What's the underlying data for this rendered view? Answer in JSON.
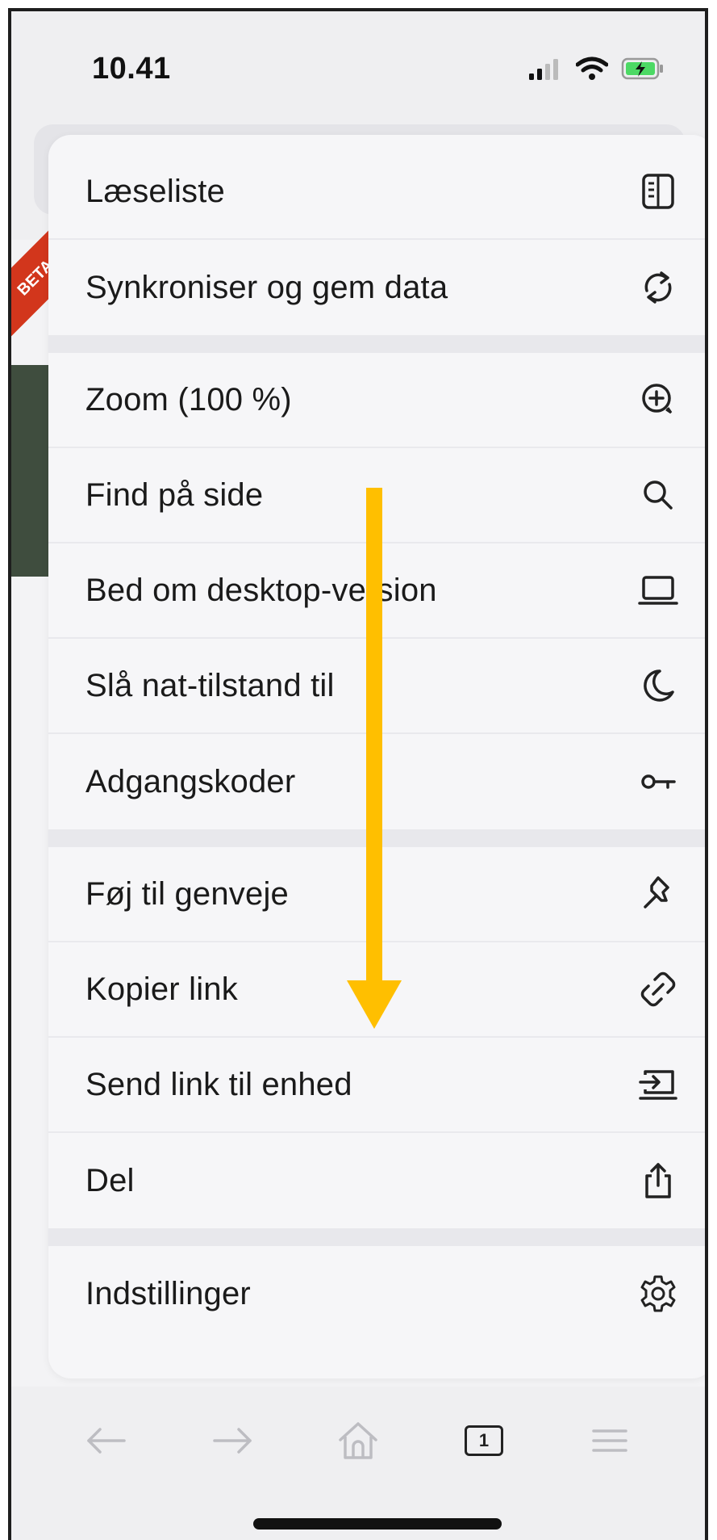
{
  "status_bar": {
    "time": "10.41",
    "signal_icon": "cellular-signal-icon",
    "wifi_icon": "wifi-icon",
    "battery_icon": "battery-charging-icon"
  },
  "background": {
    "ribbon_text": "BETA"
  },
  "menu": {
    "groups": [
      [
        {
          "label": "Læseliste",
          "icon": "reading-list-icon"
        },
        {
          "label": "Synkroniser og gem data",
          "icon": "sync-icon"
        }
      ],
      [
        {
          "label": "Zoom (100 %)",
          "icon": "zoom-in-icon"
        },
        {
          "label": "Find på side",
          "icon": "search-icon"
        },
        {
          "label": "Bed om desktop-version",
          "icon": "laptop-icon"
        },
        {
          "label": "Slå nat-tilstand til",
          "icon": "moon-icon"
        },
        {
          "label": "Adgangskoder",
          "icon": "key-icon"
        }
      ],
      [
        {
          "label": "Føj til genveje",
          "icon": "pin-icon"
        },
        {
          "label": "Kopier link",
          "icon": "link-icon"
        },
        {
          "label": "Send link til enhed",
          "icon": "send-to-device-icon"
        },
        {
          "label": "Del",
          "icon": "share-icon"
        }
      ],
      [
        {
          "label": "Indstillinger",
          "icon": "gear-icon"
        }
      ]
    ]
  },
  "toolbar": {
    "back_icon": "arrow-left-icon",
    "forward_icon": "arrow-right-icon",
    "home_icon": "home-icon",
    "tab_count": "1",
    "menu_icon": "hamburger-menu-icon"
  },
  "colors": {
    "annotation_arrow": "#FFBF00",
    "ribbon": "#d2361c"
  }
}
